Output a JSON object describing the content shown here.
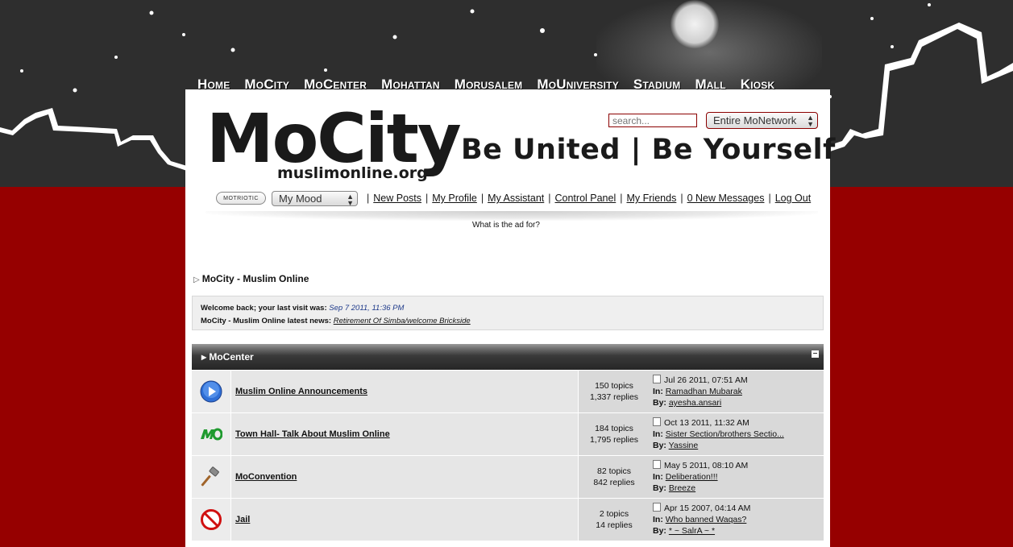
{
  "nav": [
    "Home",
    "MoCity",
    "MoCenter",
    "Mohattan",
    "Morusalem",
    "MoUniversity",
    "Stadium",
    "Mall",
    "Kiosk"
  ],
  "logo": {
    "title": "MoCity",
    "domain": "muslimonline.org",
    "tagline": "Be United | Be Yourself"
  },
  "search": {
    "placeholder": "search...",
    "scope": "Entire MoNetwork"
  },
  "userbar": {
    "badge": "MOTRIOTIC",
    "mood": "My Mood",
    "links": [
      "New Posts",
      "My Profile",
      "My Assistant",
      "Control Panel",
      "My Friends",
      "0 New Messages",
      "Log Out"
    ]
  },
  "ad_note": "What is the ad for?",
  "breadcrumb": "MoCity - Muslim Online",
  "welcome": {
    "line1_label": "Welcome back; your last visit was:",
    "last_visit": "Sep 7 2011, 11:36 PM",
    "line2_label": "MoCity - Muslim Online latest news:",
    "news": "Retirement Of Simba/welcome Brickside"
  },
  "category": {
    "title": "MoCenter"
  },
  "forums": [
    {
      "icon": "play-icon",
      "name": "Muslim Online Announcements",
      "topics": "150 topics",
      "replies": "1,337 replies",
      "last_date": "Jul 26 2011, 07:51 AM",
      "in_label": "In:",
      "last_topic": "Ramadhan Mubarak",
      "by_label": "By:",
      "last_user": "ayesha.ansari"
    },
    {
      "icon": "mo-logo-icon",
      "name": "Town Hall- Talk About Muslim Online",
      "topics": "184 topics",
      "replies": "1,795 replies",
      "last_date": "Oct 13 2011, 11:32 AM",
      "in_label": "In:",
      "last_topic": "Sister Section/brothers Sectio...",
      "by_label": "By:",
      "last_user": "Yassine"
    },
    {
      "icon": "gavel-icon",
      "name": "MoConvention",
      "topics": "82 topics",
      "replies": "842 replies",
      "last_date": "May 5 2011, 08:10 AM",
      "in_label": "In:",
      "last_topic": "Deliberation!!!",
      "by_label": "By:",
      "last_user": "Breeze"
    },
    {
      "icon": "no-entry-icon",
      "name": "Jail",
      "topics": "2 topics",
      "replies": "14 replies",
      "last_date": "Apr 15 2007, 04:14 AM",
      "in_label": "In:",
      "last_topic": "Who banned Waqas?",
      "by_label": "By:",
      "last_user": "* ~ SalrA ~ *"
    }
  ]
}
